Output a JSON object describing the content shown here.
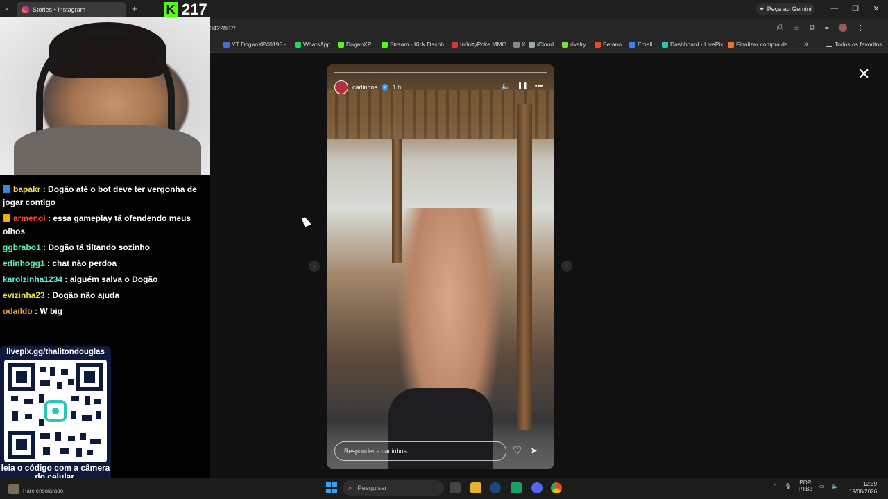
{
  "browser": {
    "tab_title": "Stories • Instagram",
    "tab_add": "+",
    "gemini_label": "Peça ao Gemini",
    "url": "0422867/",
    "bookmarks": [
      {
        "label": "YT DogaoXP#0195 -...",
        "color": "#4a6bd6"
      },
      {
        "label": "WhatsApp",
        "color": "#25d366"
      },
      {
        "label": "DogaoXP",
        "color": "#53fc18"
      },
      {
        "label": "Stream - Kick Dashb...",
        "color": "#53fc18"
      },
      {
        "label": "InfinityPoke MMO",
        "color": "#d33"
      },
      {
        "label": "X",
        "color": "#888"
      },
      {
        "label": "iCloud",
        "color": "#9aa"
      },
      {
        "label": "rivalry",
        "color": "#7fe030"
      },
      {
        "label": "Betano",
        "color": "#e43"
      },
      {
        "label": "Email",
        "color": "#3b82f6"
      },
      {
        "label": "Dashboard - LivePix",
        "color": "#2ec4b6"
      },
      {
        "label": "Finalizar compra da...",
        "color": "#f07030"
      }
    ],
    "all_favorites": "Todos os favoritos",
    "overflow": "»"
  },
  "stream_overlay": {
    "kick_count": "217",
    "kick_logo": "K",
    "chat": [
      {
        "user": "bapakr",
        "user_color": "#f0e040",
        "badge_color": "#2f8fd6",
        "message": ": Dogão até o bot deve ter vergonha de jogar contigo"
      },
      {
        "user": "armenoi",
        "user_color": "#ff4a3a",
        "badge_color": "#e8b400",
        "message": ": essa gameplay tá ofendendo meus olhos"
      },
      {
        "user": "ggbrabo1",
        "user_color": "#5af0b0",
        "badge_color": "",
        "message": ": Dogão tá tiltando sozinho"
      },
      {
        "user": "edinhogg1",
        "user_color": "#5af0b0",
        "badge_color": "",
        "message": ": chat não perdoa"
      },
      {
        "user": "karolzinha1234",
        "user_color": "#5af0e0",
        "badge_color": "",
        "message": ": alguém salva o Dogão"
      },
      {
        "user": "evizinha23",
        "user_color": "#f0e040",
        "badge_color": "",
        "message": ": Dogão não ajuda"
      },
      {
        "user": "odaildo",
        "user_color": "#f0a040",
        "badge_color": "",
        "message": ": W big"
      }
    ],
    "qr_url": "livepix.gg/thalitondouglas",
    "qr_caption": "leia o código com a câmera do celular."
  },
  "story": {
    "username": "carlinhos",
    "time": "1 h",
    "reply_placeholder": "Responder a carlinhos..."
  },
  "icons": {
    "close": "✕",
    "mute": "🔈",
    "pause": "❚❚",
    "more": "•••",
    "heart": "♡",
    "send": "➤",
    "prev": "‹",
    "next": "›",
    "verified": "✔"
  },
  "taskbar": {
    "weather": "Parc ensolarado",
    "search": "Pesquisar",
    "lang": "POR",
    "lang2": "PTB2",
    "time": "12:39",
    "date": "19/08/2026"
  },
  "window": {
    "minimize": "—",
    "maximize": "❐",
    "close": "✕"
  }
}
